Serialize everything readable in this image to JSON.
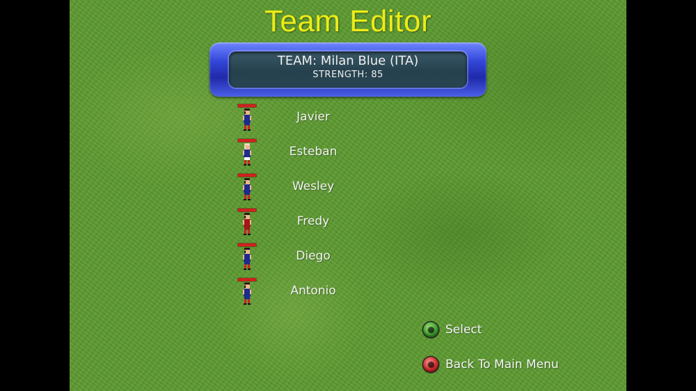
{
  "screen": {
    "title": "Team Editor"
  },
  "team": {
    "name_line": "TEAM: Milan Blue (ITA)",
    "strength_line": "STRENGTH: 85"
  },
  "players": [
    {
      "name": "Javier",
      "skin": "dark",
      "kit": "blue"
    },
    {
      "name": "Esteban",
      "skin": "bald",
      "kit": "blue"
    },
    {
      "name": "Wesley",
      "skin": "dark",
      "kit": "blue"
    },
    {
      "name": "Fredy",
      "skin": "dark",
      "kit": "red"
    },
    {
      "name": "Diego",
      "skin": "dark",
      "kit": "blue"
    },
    {
      "name": "Antonio",
      "skin": "dark",
      "kit": "blue"
    }
  ],
  "controls": {
    "select_label": "Select",
    "back_label": "Back To Main Menu"
  },
  "colors": {
    "title": "#ecec16",
    "panel_border": "#3346d8",
    "health_bar": "#d41f1f",
    "kit_blue": "#1e2a8c",
    "kit_red": "#a31818",
    "button_green": "#3f9b2d",
    "button_red": "#d32b2b"
  }
}
